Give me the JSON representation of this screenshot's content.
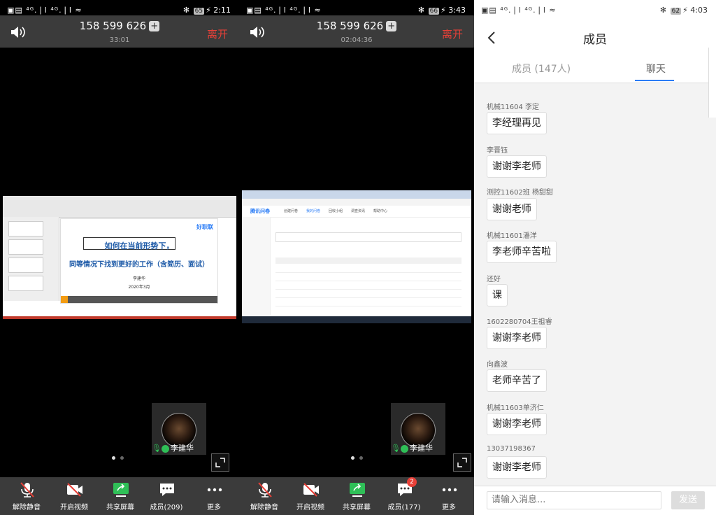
{
  "panels": [
    {
      "status": {
        "carrier": "▣▤ ⁴ᴳ.❘l ⁴ᴳ.❘l ≈",
        "battery": "65",
        "time": "2:11"
      },
      "header": {
        "meeting_id": "158 599 626",
        "duration": "33:01",
        "leave_label": "离开"
      },
      "slide": {
        "title_line1": "如何在当前形势下，",
        "title_line2": "同等情况下找到更好的工作（含简历、面试）",
        "presenter": "李建华",
        "date": "2020年3月",
        "logo": "好职联"
      },
      "participant_name": "李建华",
      "toolbar": {
        "unmute": "解除静音",
        "video": "开启视频",
        "share": "共享屏幕",
        "members": "成员(209)",
        "more": "更多"
      }
    },
    {
      "status": {
        "carrier": "▣▤ ⁴ᴳ.❘l ⁴ᴳ.❘l ≈",
        "battery": "66",
        "time": "3:43"
      },
      "header": {
        "meeting_id": "158 599 626",
        "duration": "02:04:36",
        "leave_label": "离开"
      },
      "screen": {
        "app": "腾讯问卷",
        "tabs": [
          "创建问卷",
          "我的问卷",
          "回收小组",
          "调查资讯",
          "帮助中心"
        ]
      },
      "participant_name": "李建华",
      "toolbar": {
        "unmute": "解除静音",
        "video": "开启视频",
        "share": "共享屏幕",
        "members": "成员(177)",
        "more": "更多",
        "badge": "2"
      }
    }
  ],
  "members_page": {
    "status": {
      "carrier": "▣▤ ⁴ᴳ.❘l ⁴ᴳ.❘l ≈",
      "battery": "62",
      "time": "4:03"
    },
    "title": "成员",
    "tab_members": "成员 (147人)",
    "tab_chat": "聊天",
    "messages": [
      {
        "sender": "机械11604 李定",
        "text": "李经理再见"
      },
      {
        "sender": "李晋钰",
        "text": "谢谢李老师"
      },
      {
        "sender": "测控11602班 杨甜甜",
        "text": "谢谢老师"
      },
      {
        "sender": "机械11601潘洋",
        "text": "李老师辛苦啦"
      },
      {
        "sender": "还好",
        "text": "课"
      },
      {
        "sender": "1602280704王祖睿",
        "text": "谢谢李老师"
      },
      {
        "sender": "向鑫波",
        "text": "老师辛苦了"
      },
      {
        "sender": "机械11603单济仁",
        "text": "谢谢李老师"
      },
      {
        "sender": "13037198367",
        "text": "谢谢李老师"
      }
    ],
    "input_placeholder": "请输入消息...",
    "send_label": "发送"
  }
}
